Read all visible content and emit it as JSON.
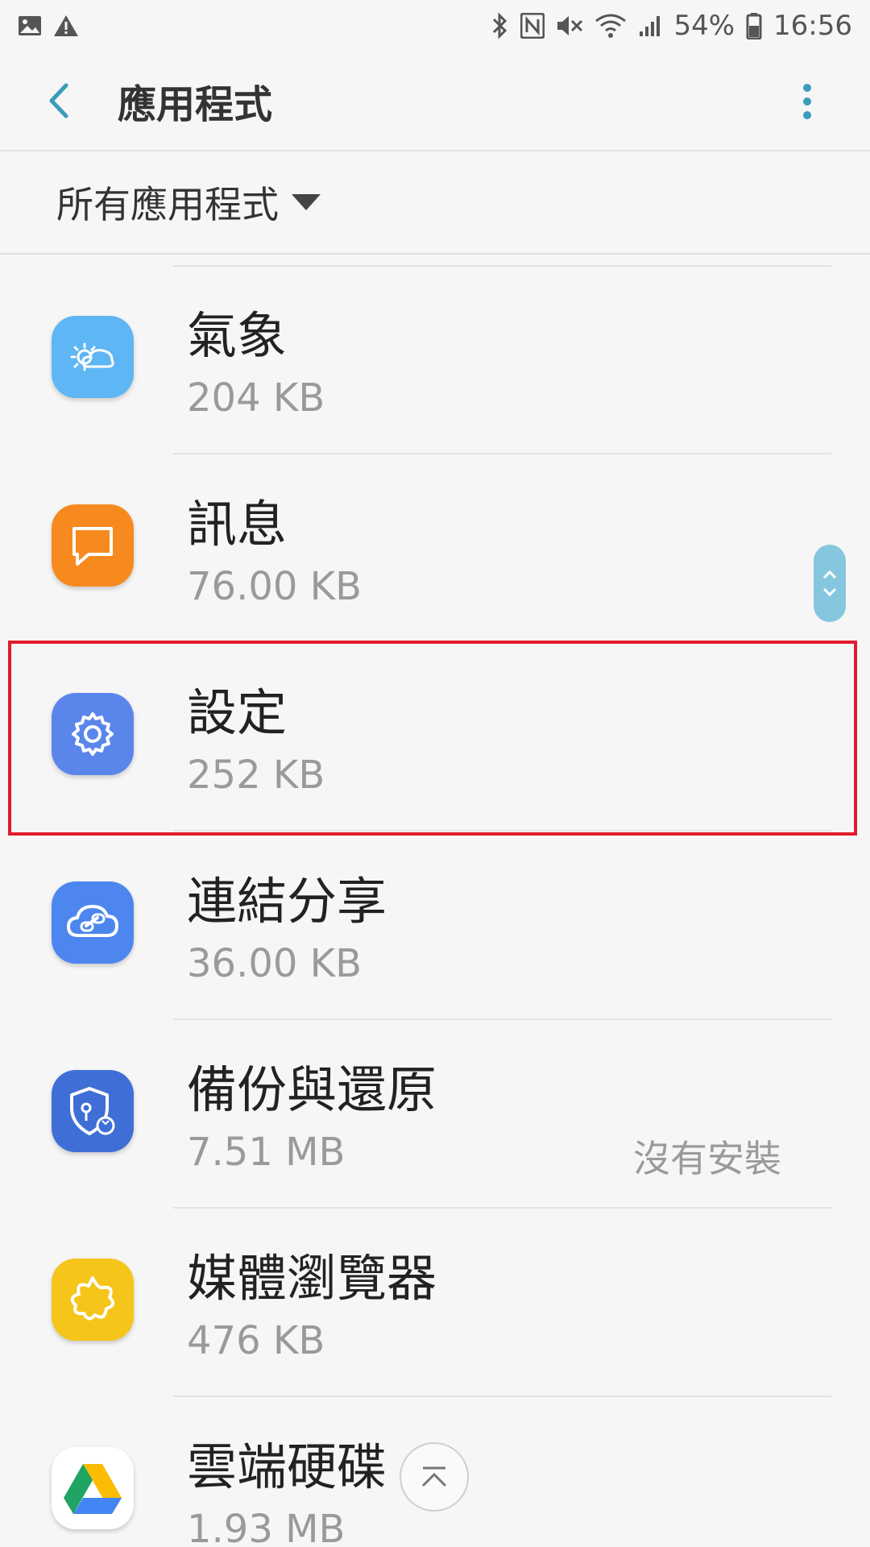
{
  "status_bar": {
    "battery_text": "54%",
    "time": "16:56",
    "icons": [
      "image-icon",
      "warning-icon",
      "bluetooth-icon",
      "nfc-icon",
      "mute-icon",
      "wifi-icon",
      "signal-icon",
      "battery-icon"
    ]
  },
  "header": {
    "title": "應用程式"
  },
  "filter": {
    "label": "所有應用程式"
  },
  "apps": [
    {
      "name": "氣象",
      "size": "204 KB",
      "note": "",
      "icon": "weather-icon",
      "color": "#5fb6f5"
    },
    {
      "name": "訊息",
      "size": "76.00 KB",
      "note": "",
      "icon": "messages-icon",
      "color": "#f68a1f"
    },
    {
      "name": "設定",
      "size": "252 KB",
      "note": "",
      "icon": "settings-gear-icon",
      "color": "#5a86ec"
    },
    {
      "name": "連結分享",
      "size": "36.00 KB",
      "note": "",
      "icon": "link-sharing-icon",
      "color": "#4d86ef"
    },
    {
      "name": "備份與還原",
      "size": "7.51 MB",
      "note": "沒有安裝",
      "icon": "backup-restore-icon",
      "color": "#3f6fd6"
    },
    {
      "name": "媒體瀏覽器",
      "size": "476 KB",
      "note": "",
      "icon": "media-browser-icon",
      "color": "#f5c51a"
    },
    {
      "name": "雲端硬碟",
      "size": "1.93 MB",
      "note": "",
      "icon": "google-drive-icon",
      "color": "#ffffff"
    }
  ]
}
